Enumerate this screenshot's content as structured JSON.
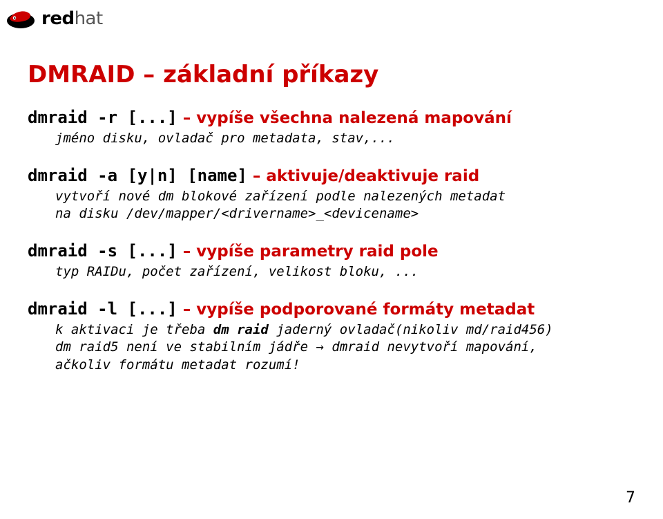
{
  "logo": {
    "brand_red": "red",
    "brand_hat": "hat"
  },
  "title": "DMRAID – základní příkazy",
  "sections": [
    {
      "cmd": "dmraid -r [...]",
      "req": " – vypíše všechna nalezená mapování",
      "desc_lines": [
        "jméno disku, ovladač pro metadata, stav,..."
      ]
    },
    {
      "cmd": "dmraid -a [y|n] [name]",
      "req": " – aktivuje/deaktivuje raid",
      "desc_lines": [
        "vytvoří nové dm blokové zařízení podle nalezených metadat",
        "na disku /dev/mapper/<drivername>_<devicename>"
      ]
    },
    {
      "cmd": "dmraid -s [...]",
      "req": " – vypíše parametry raid pole",
      "desc_lines": [
        "typ RAIDu, počet zařízení, velikost bloku, ..."
      ]
    },
    {
      "cmd": "dmraid -l [...]",
      "req": " – vypíše podporované formáty metadat",
      "desc_lines_rich": {
        "pre": "k aktivaci je třeba ",
        "bold": "dm raid",
        "mid": " jaderný ovladač(nikoliv md/raid456)",
        "line2_a": "dm raid5 není ve stabilním jádře ",
        "line2_arrow": "→",
        "line2_b": " dmraid nevytvoří mapování,",
        "line3": "ačkoliv formátu metadat rozumí!"
      }
    }
  ],
  "page_number": "7"
}
